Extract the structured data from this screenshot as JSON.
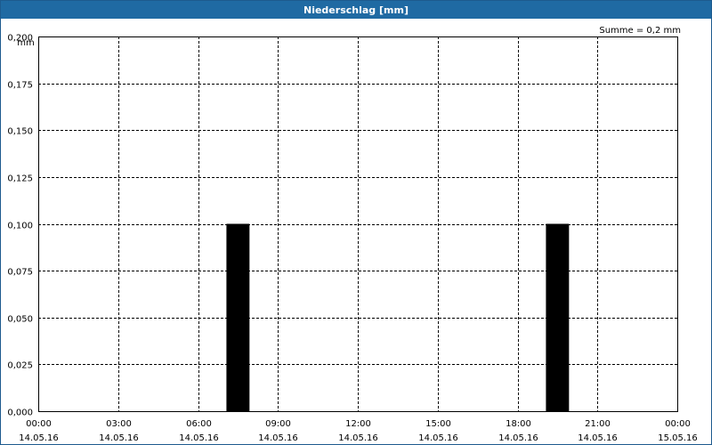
{
  "window": {
    "title": "Niederschlag [mm]"
  },
  "summary": "Summe = 0,2 mm",
  "colors": {
    "titlebar": "#1f6aa3",
    "bar": "#000000",
    "grid": "#000000"
  },
  "chart_data": {
    "type": "bar",
    "title": "Niederschlag [mm]",
    "ylabel": "mm",
    "ylim": [
      0,
      0.2
    ],
    "grid": true,
    "y_ticks": [
      "0,000",
      "0,025",
      "0,050",
      "0,075",
      "0,100",
      "0,125",
      "0,150",
      "0,175",
      "0,200"
    ],
    "x_ticks": [
      {
        "time": "00:00",
        "date": "14.05.16"
      },
      {
        "time": "03:00",
        "date": "14.05.16"
      },
      {
        "time": "06:00",
        "date": "14.05.16"
      },
      {
        "time": "09:00",
        "date": "14.05.16"
      },
      {
        "time": "12:00",
        "date": "14.05.16"
      },
      {
        "time": "15:00",
        "date": "14.05.16"
      },
      {
        "time": "18:00",
        "date": "14.05.16"
      },
      {
        "time": "21:00",
        "date": "14.05.16"
      },
      {
        "time": "00:00",
        "date": "15.05.16"
      }
    ],
    "xlim": [
      "14.05.16 00:00",
      "15.05.16 00:00"
    ],
    "bars": [
      {
        "start": "14.05.16 07:00",
        "end": "14.05.16 08:00",
        "value": 0.1
      },
      {
        "start": "14.05.16 19:00",
        "end": "14.05.16 20:00",
        "value": 0.1
      }
    ]
  }
}
